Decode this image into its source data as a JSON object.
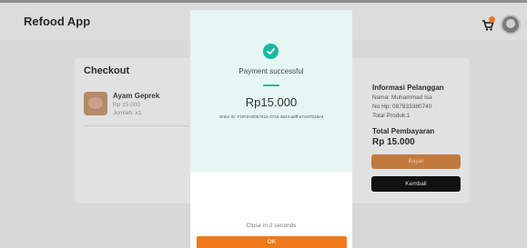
{
  "app": {
    "title": "Refood App"
  },
  "header": {
    "cart_icon": "cart-icon",
    "avatar_icon": "avatar"
  },
  "checkout": {
    "title": "Checkout",
    "item": {
      "name": "Ayam Geprek",
      "price": "Rp 15.000",
      "qty": "Jumlah: x1"
    }
  },
  "customer": {
    "title": "Informasi Pelanggan",
    "name": "Nama: Muhammad Isa",
    "phone": "No Hp: 087833380740",
    "products": "Total Produk:1"
  },
  "payment": {
    "title": "Total Pembayaran",
    "amount": "Rp 15.000",
    "pay_label": "Bayar",
    "back_label": "Kembali"
  },
  "modal": {
    "status_icon": "check-circle-icon",
    "status": "Payment successful",
    "amount": "Rp15.000",
    "order_id": "Order ID: FORD-6f06761e-3722-4524-a8ff-a7c87f245e4",
    "close_text": "Close in 2 seconds",
    "ok_label": "OK"
  },
  "colors": {
    "accent_teal": "#16b9a0",
    "accent_orange": "#f07a1a",
    "modal_top_bg": "#e6f6f2"
  }
}
